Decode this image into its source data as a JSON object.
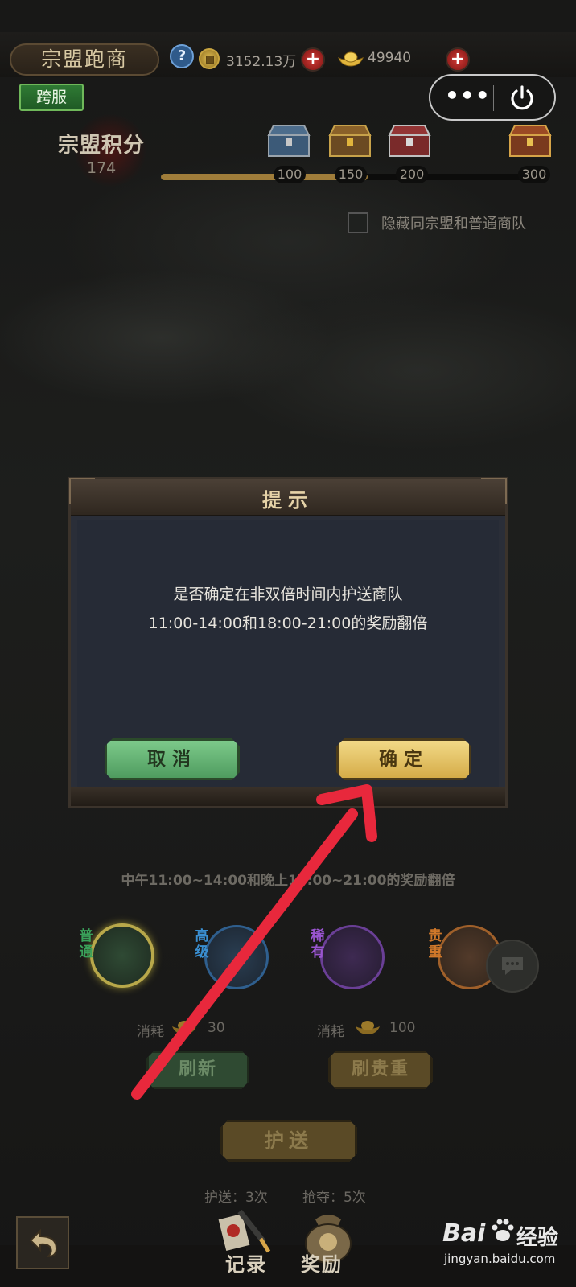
{
  "header": {
    "title": "宗盟跑商",
    "help_icon": "?",
    "coins_value": "3152.13万",
    "gold_value": "49940",
    "plus_symbol": "+"
  },
  "badge_cross_server": "跨服",
  "mini_program": {
    "more_icon": "•••"
  },
  "score": {
    "label": "宗盟积分",
    "value": "174",
    "progress_fraction": 0.55,
    "milestones": [
      "100",
      "150",
      "200",
      "300"
    ]
  },
  "options": {
    "hide_label": "隐藏同宗盟和普通商队"
  },
  "dialog": {
    "title": "提示",
    "line1": "是否确定在非双倍时间内护送商队",
    "line2": "11:00-14:00和18:00-21:00的奖励翻倍",
    "cancel_label": "取消",
    "ok_label": "确定"
  },
  "promo_text": "中午11:00~14:00和晚上18:00~21:00的奖励翻倍",
  "caravans": [
    {
      "tier": "普通",
      "color": "#3aa15a"
    },
    {
      "tier": "高级",
      "color": "#3a8fd1"
    },
    {
      "tier": "稀有",
      "color": "#9a55d0"
    },
    {
      "tier": "贵重",
      "color": "#d0782a"
    }
  ],
  "costs": {
    "label": "消耗",
    "refresh_cost": "30",
    "premium_cost": "100"
  },
  "buttons": {
    "refresh": "刷新",
    "refresh_premium": "刷贵重",
    "escort": "护送"
  },
  "counts": {
    "escort": "护送：3次",
    "rob": "抢夺：5次"
  },
  "bottom": {
    "records": "记录",
    "rewards": "奖励"
  },
  "watermark": {
    "brand": "Bai",
    "brand_suffix": "经验",
    "url": "jingyan.baidu.com"
  },
  "colors": {
    "accent_gold": "#d5ac48",
    "cancel_green": "#4f9c5f",
    "arrow_red": "#e8283c"
  }
}
